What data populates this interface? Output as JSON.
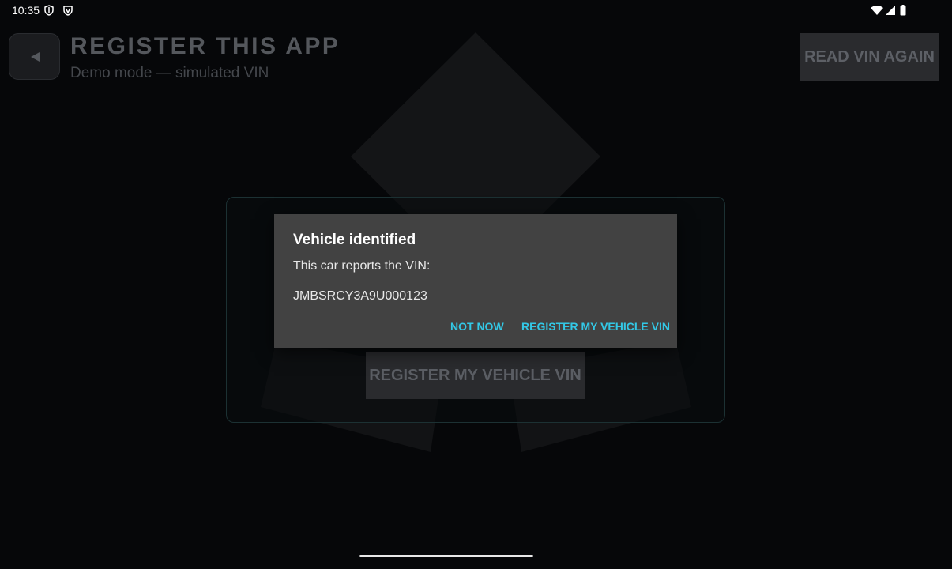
{
  "status_bar": {
    "time": "10:35",
    "icons_left": [
      "shield-icon",
      "vpn-shield-icon"
    ],
    "icons_right": [
      "wifi-icon",
      "signal-icon",
      "battery-icon"
    ]
  },
  "header": {
    "back_icon": "back-arrow-icon",
    "title": "REGISTER THIS APP",
    "subtitle": "Demo mode — simulated VIN",
    "read_vin_label": "READ VIN AGAIN"
  },
  "card": {
    "register_label": "REGISTER MY VEHICLE VIN"
  },
  "dialog": {
    "title": "Vehicle identified",
    "message": "This car reports the VIN:",
    "vin": "JMBSRCY3A9U000123",
    "negative_label": "NOT NOW",
    "positive_label": "REGISTER MY VEHICLE VIN",
    "accent_color": "#33c8e6"
  },
  "colors": {
    "background": "#060709",
    "dialog_background": "#424242",
    "card_border": "#1c3133"
  }
}
